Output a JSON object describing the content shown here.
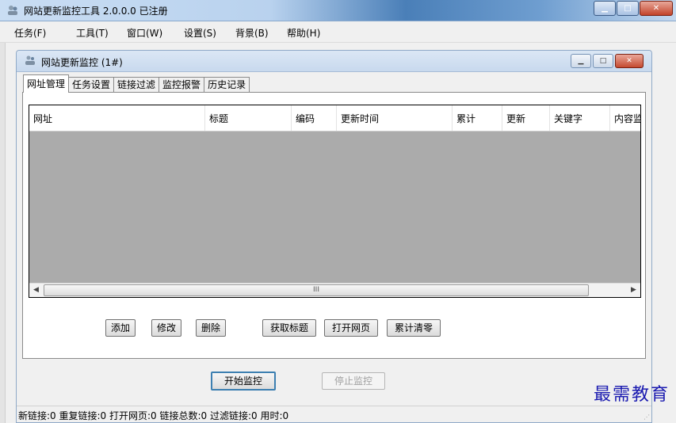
{
  "app": {
    "title": "网站更新监控工具 2.0.0.0 已注册"
  },
  "menu": [
    "任务(F)",
    "工具(T)",
    "窗口(W)",
    "设置(S)",
    "背景(B)",
    "帮助(H)"
  ],
  "child": {
    "title": "网站更新监控  (1#)",
    "tabs": [
      "网址管理",
      "任务设置",
      "链接过滤",
      "监控报警",
      "历史记录"
    ]
  },
  "table": {
    "columns": [
      "网址",
      "标题",
      "编码",
      "更新时间",
      "累计",
      "更新",
      "关键字",
      "内容监"
    ],
    "scroll_marker": "III"
  },
  "actions": [
    "添加",
    "修改",
    "删除",
    "获取标题",
    "打开网页",
    "累计清零"
  ],
  "monitor": {
    "start": "开始监控",
    "stop": "停止监控"
  },
  "status": "新链接:0  重复链接:0  打开网页:0  链接总数:0  过滤链接:0  用时:0",
  "watermark": "最需教育",
  "colors": {
    "accent": "#3c7fb1",
    "list_bg": "#ababab",
    "watermark": "#1a1ab0"
  }
}
